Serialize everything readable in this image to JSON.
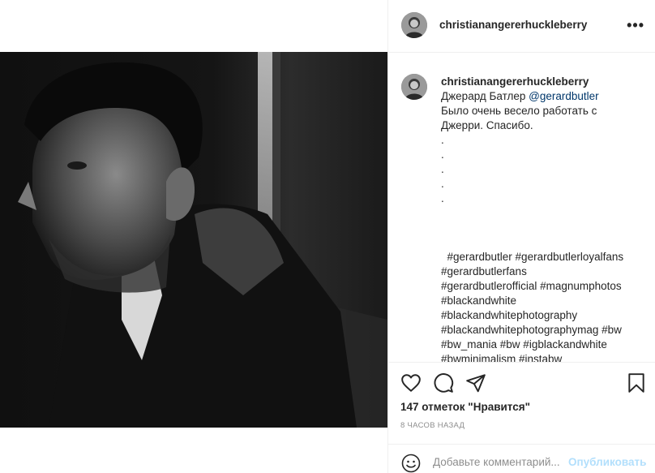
{
  "post": {
    "image_alt": "Black and white portrait photograph",
    "header": {
      "username": "christianangererhuckleberry",
      "more": "•••"
    },
    "caption": {
      "author": "christianangererhuckleberry",
      "name_prefix": "Джерард Батлер ",
      "mention": "@gerardbutler",
      "line2": "Было очень весело работать с",
      "line3": "Джерри. Спасибо.",
      "dots": [
        ".",
        ".",
        ".",
        ".",
        "."
      ],
      "hashtags": [
        "  #gerardbutler #gerardbutlerloyalfans",
        "#gerardbutlerfans",
        "#gerardbutlerofficial #magnumphotos",
        "#blackandwhite",
        "#blackandwhitephotography",
        "#blackandwhitephotographymag #bw",
        "#bw_mania #bw #igblackandwhite",
        "#bwminimalism #instabw"
      ]
    },
    "likes": "147 отметок \"Нравится\"",
    "time_ago": "8 ЧАСОВ НАЗАД",
    "comment": {
      "placeholder": "Добавьте комментарий...",
      "publish": "Опубликовать"
    },
    "icons": [
      "heart-icon",
      "comment-icon",
      "share-icon",
      "bookmark-icon",
      "emoji-icon",
      "more-icon"
    ]
  }
}
